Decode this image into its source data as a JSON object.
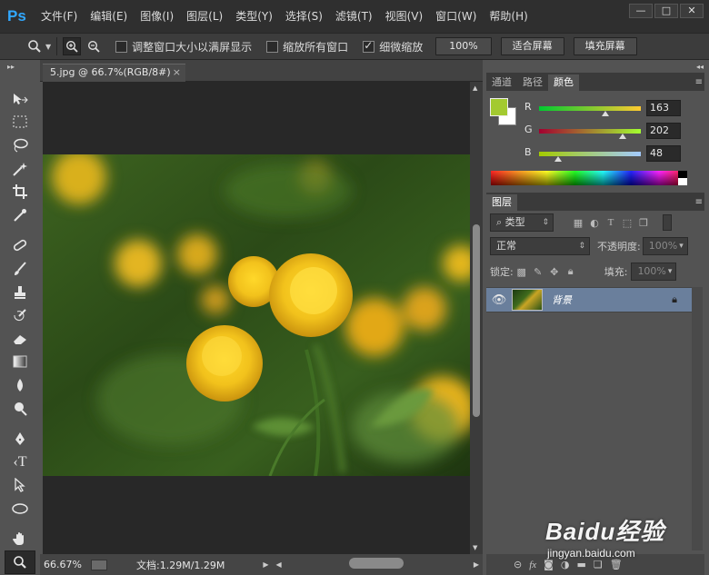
{
  "app": {
    "logo": "Ps"
  },
  "menu": [
    "文件(F)",
    "编辑(E)",
    "图像(I)",
    "图层(L)",
    "类型(Y)",
    "选择(S)",
    "滤镜(T)",
    "视图(V)",
    "窗口(W)",
    "帮助(H)"
  ],
  "window_controls": {
    "minimize": "—",
    "maximize": "□",
    "close": "✕"
  },
  "options_bar": {
    "chk1_label": "调整窗口大小以满屏显示",
    "chk2_label": "缩放所有窗口",
    "chk3_label": "细微缩放",
    "chk3_checked": true,
    "btn_100": "100%",
    "btn_fit": "适合屏幕",
    "btn_fill": "填充屏幕"
  },
  "document": {
    "tab_title": "5.jpg @ 66.7%(RGB/8#)",
    "tab_close": "×"
  },
  "status_bar": {
    "zoom": "66.67%",
    "doc_info": "文档:1.29M/1.29M"
  },
  "color_panel": {
    "tabs": [
      "通道",
      "路径",
      "颜色"
    ],
    "active_tab": "颜色",
    "fg_color": "#a3ca30",
    "r_label": "R",
    "r_value": "163",
    "g_label": "G",
    "g_value": "202",
    "b_label": "B",
    "b_value": "48"
  },
  "layers_panel": {
    "title": "图层",
    "filter_label": "类型",
    "blend_mode": "正常",
    "opacity_label": "不透明度:",
    "opacity_value": "100%",
    "lock_label": "锁定:",
    "fill_label": "填充:",
    "fill_value": "100%",
    "layers": [
      {
        "name": "背景",
        "locked": true,
        "visible": true
      }
    ]
  },
  "tools": [
    "move-tool",
    "marquee-tool",
    "lasso-tool",
    "magic-wand-tool",
    "crop-tool",
    "eyedropper-tool",
    "healing-brush-tool",
    "brush-tool",
    "clone-stamp-tool",
    "history-brush-tool",
    "eraser-tool",
    "gradient-tool",
    "blur-tool",
    "dodge-tool",
    "pen-tool",
    "type-tool",
    "path-selection-tool",
    "ellipse-tool",
    "hand-tool",
    "zoom-tool"
  ],
  "watermark": {
    "logo": "Baidu经验",
    "url": "jingyan.baidu.com"
  }
}
